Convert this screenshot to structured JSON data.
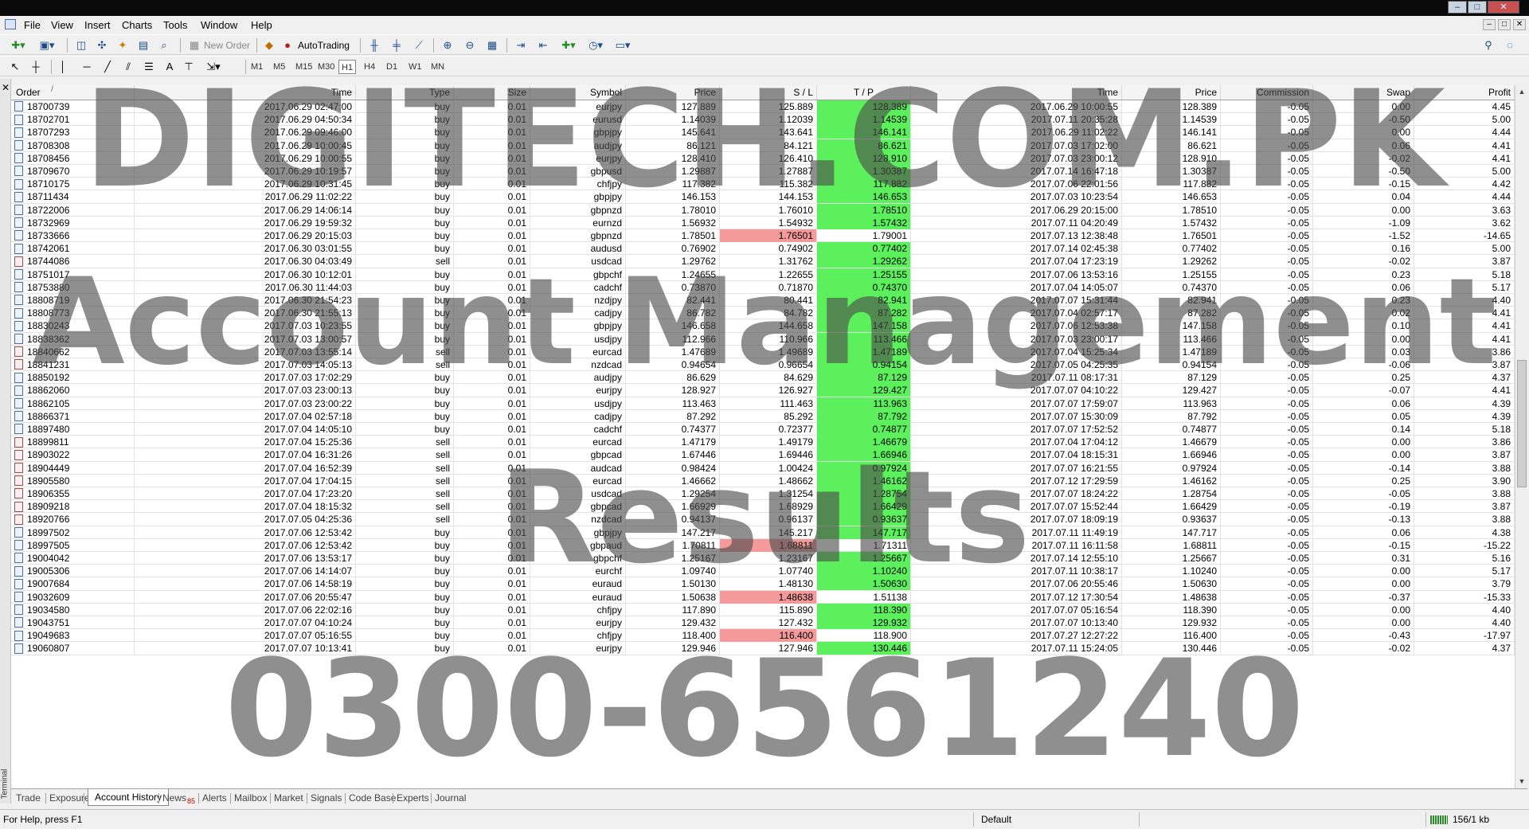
{
  "window": {
    "controls": [
      "–",
      "□",
      "✕"
    ]
  },
  "menu": [
    "File",
    "View",
    "Insert",
    "Charts",
    "Tools",
    "Window",
    "Help"
  ],
  "toolbar": {
    "new_order_label": "New Order",
    "autotrading_label": "AutoTrading",
    "timeframes": [
      "M1",
      "M5",
      "M15",
      "M30",
      "H1",
      "H4",
      "D1",
      "W1",
      "MN"
    ],
    "active_timeframe": "H1"
  },
  "terminal_label": "Terminal",
  "table": {
    "columns": [
      "Order",
      "Time",
      "Type",
      "Size",
      "Symbol",
      "Price",
      "S / L",
      "T / P",
      "Time",
      "Price",
      "Commission",
      "Swap",
      "Profit"
    ],
    "sort_indicator": "/",
    "rows": [
      [
        "18700739",
        "2017.06.29 02:47:00",
        "buy",
        "0.01",
        "eurjpy",
        "127.889",
        "125.889",
        "128.389",
        "2017.06.29 10:00:55",
        "128.389",
        "-0.05",
        "0.00",
        "4.45",
        "tp"
      ],
      [
        "18702701",
        "2017.06.29 04:50:34",
        "buy",
        "0.01",
        "eurusd",
        "1.14039",
        "1.12039",
        "1.14539",
        "2017.07.11 20:35:28",
        "1.14539",
        "-0.05",
        "-0.50",
        "5.00",
        "tp"
      ],
      [
        "18707293",
        "2017.06.29 09:46:00",
        "buy",
        "0.01",
        "gbpjpy",
        "145.641",
        "143.641",
        "146.141",
        "2017.06.29 11:02:22",
        "146.141",
        "-0.05",
        "0.00",
        "4.44",
        "tp"
      ],
      [
        "18708308",
        "2017.06.29 10:00:45",
        "buy",
        "0.01",
        "audjpy",
        "86.121",
        "84.121",
        "86.621",
        "2017.07.03 17:02:00",
        "86.621",
        "-0.05",
        "0.06",
        "4.41",
        "tp"
      ],
      [
        "18708456",
        "2017.06.29 10:00:55",
        "buy",
        "0.01",
        "eurjpy",
        "128.410",
        "126.410",
        "128.910",
        "2017.07.03 23:00:12",
        "128.910",
        "-0.05",
        "-0.02",
        "4.41",
        "tp"
      ],
      [
        "18709670",
        "2017.06.29 10:19:57",
        "buy",
        "0.01",
        "gbpusd",
        "1.29887",
        "1.27887",
        "1.30387",
        "2017.07.14 16:47:18",
        "1.30387",
        "-0.05",
        "-0.50",
        "5.00",
        "tp"
      ],
      [
        "18710175",
        "2017.06.29 10:31:45",
        "buy",
        "0.01",
        "chfjpy",
        "117.382",
        "115.382",
        "117.882",
        "2017.07.06 22:01:56",
        "117.882",
        "-0.05",
        "-0.15",
        "4.42",
        "tp"
      ],
      [
        "18711434",
        "2017.06.29 11:02:22",
        "buy",
        "0.01",
        "gbpjpy",
        "146.153",
        "144.153",
        "146.653",
        "2017.07.03 10:23:54",
        "146.653",
        "-0.05",
        "0.04",
        "4.44",
        "tp"
      ],
      [
        "18722006",
        "2017.06.29 14:06:14",
        "buy",
        "0.01",
        "gbpnzd",
        "1.78010",
        "1.76010",
        "1.78510",
        "2017.06.29 20:15:00",
        "1.78510",
        "-0.05",
        "0.00",
        "3.63",
        "tp"
      ],
      [
        "18732969",
        "2017.06.29 19:59:32",
        "buy",
        "0.01",
        "eurnzd",
        "1.56932",
        "1.54932",
        "1.57432",
        "2017.07.11 04:20:49",
        "1.57432",
        "-0.05",
        "-1.09",
        "3.62",
        "tp"
      ],
      [
        "18733666",
        "2017.06.29 20:15:03",
        "buy",
        "0.01",
        "gbpnzd",
        "1.78501",
        "1.76501",
        "1.79001",
        "2017.07.13 12:38:48",
        "1.76501",
        "-0.05",
        "-1.52",
        "-14.65",
        "sl"
      ],
      [
        "18742061",
        "2017.06.30 03:01:55",
        "buy",
        "0.01",
        "audusd",
        "0.76902",
        "0.74902",
        "0.77402",
        "2017.07.14 02:45:38",
        "0.77402",
        "-0.05",
        "0.16",
        "5.00",
        "tp"
      ],
      [
        "18744086",
        "2017.06.30 04:03:49",
        "sell",
        "0.01",
        "usdcad",
        "1.29762",
        "1.31762",
        "1.29262",
        "2017.07.04 17:23:19",
        "1.29262",
        "-0.05",
        "-0.02",
        "3.87",
        "tp"
      ],
      [
        "18751017",
        "2017.06.30 10:12:01",
        "buy",
        "0.01",
        "gbpchf",
        "1.24655",
        "1.22655",
        "1.25155",
        "2017.07.06 13:53:16",
        "1.25155",
        "-0.05",
        "0.23",
        "5.18",
        "tp"
      ],
      [
        "18753880",
        "2017.06.30 11:44:03",
        "buy",
        "0.01",
        "cadchf",
        "0.73870",
        "0.71870",
        "0.74370",
        "2017.07.04 14:05:07",
        "0.74370",
        "-0.05",
        "0.06",
        "5.17",
        "tp"
      ],
      [
        "18808719",
        "2017.06.30 21:54:23",
        "buy",
        "0.01",
        "nzdjpy",
        "82.441",
        "80.441",
        "82.941",
        "2017.07.07 15:31:44",
        "82.941",
        "-0.05",
        "0.23",
        "4.40",
        "tp"
      ],
      [
        "18808773",
        "2017.06.30 21:55:13",
        "buy",
        "0.01",
        "cadjpy",
        "86.782",
        "84.782",
        "87.282",
        "2017.07.04 02:57:17",
        "87.282",
        "-0.05",
        "0.02",
        "4.41",
        "tp"
      ],
      [
        "18830243",
        "2017.07.03 10:23:55",
        "buy",
        "0.01",
        "gbpjpy",
        "146.658",
        "144.658",
        "147.158",
        "2017.07.06 12:53:38",
        "147.158",
        "-0.05",
        "0.10",
        "4.41",
        "tp"
      ],
      [
        "18838362",
        "2017.07.03 13:00:57",
        "buy",
        "0.01",
        "usdjpy",
        "112.966",
        "110.966",
        "113.466",
        "2017.07.03 23:00:17",
        "113.466",
        "-0.05",
        "0.00",
        "4.41",
        "tp"
      ],
      [
        "18840662",
        "2017.07.03 13:55:14",
        "sell",
        "0.01",
        "eurcad",
        "1.47689",
        "1.49689",
        "1.47189",
        "2017.07.04 15:25:34",
        "1.47189",
        "-0.05",
        "0.03",
        "3.86",
        "tp"
      ],
      [
        "18841231",
        "2017.07.03 14:05:13",
        "sell",
        "0.01",
        "nzdcad",
        "0.94654",
        "0.96654",
        "0.94154",
        "2017.07.05 04:25:35",
        "0.94154",
        "-0.05",
        "-0.06",
        "3.87",
        "tp"
      ],
      [
        "18850192",
        "2017.07.03 17:02:29",
        "buy",
        "0.01",
        "audjpy",
        "86.629",
        "84.629",
        "87.129",
        "2017.07.11 08:17:31",
        "87.129",
        "-0.05",
        "0.25",
        "4.37",
        "tp"
      ],
      [
        "18862060",
        "2017.07.03 23:00:13",
        "buy",
        "0.01",
        "eurjpy",
        "128.927",
        "126.927",
        "129.427",
        "2017.07.07 04:10:22",
        "129.427",
        "-0.05",
        "-0.07",
        "4.41",
        "tp"
      ],
      [
        "18862105",
        "2017.07.03 23:00:22",
        "buy",
        "0.01",
        "usdjpy",
        "113.463",
        "111.463",
        "113.963",
        "2017.07.07 17:59:07",
        "113.963",
        "-0.05",
        "0.06",
        "4.39",
        "tp"
      ],
      [
        "18866371",
        "2017.07.04 02:57:18",
        "buy",
        "0.01",
        "cadjpy",
        "87.292",
        "85.292",
        "87.792",
        "2017.07.07 15:30:09",
        "87.792",
        "-0.05",
        "0.05",
        "4.39",
        "tp"
      ],
      [
        "18897480",
        "2017.07.04 14:05:10",
        "buy",
        "0.01",
        "cadchf",
        "0.74377",
        "0.72377",
        "0.74877",
        "2017.07.07 17:52:52",
        "0.74877",
        "-0.05",
        "0.14",
        "5.18",
        "tp"
      ],
      [
        "18899811",
        "2017.07.04 15:25:36",
        "sell",
        "0.01",
        "eurcad",
        "1.47179",
        "1.49179",
        "1.46679",
        "2017.07.04 17:04:12",
        "1.46679",
        "-0.05",
        "0.00",
        "3.86",
        "tp"
      ],
      [
        "18903022",
        "2017.07.04 16:31:26",
        "sell",
        "0.01",
        "gbpcad",
        "1.67446",
        "1.69446",
        "1.66946",
        "2017.07.04 18:15:31",
        "1.66946",
        "-0.05",
        "0.00",
        "3.87",
        "tp"
      ],
      [
        "18904449",
        "2017.07.04 16:52:39",
        "sell",
        "0.01",
        "audcad",
        "0.98424",
        "1.00424",
        "0.97924",
        "2017.07.07 16:21:55",
        "0.97924",
        "-0.05",
        "-0.14",
        "3.88",
        "tp"
      ],
      [
        "18905580",
        "2017.07.04 17:04:15",
        "sell",
        "0.01",
        "eurcad",
        "1.46662",
        "1.48662",
        "1.46162",
        "2017.07.12 17:29:59",
        "1.46162",
        "-0.05",
        "0.25",
        "3.90",
        "tp"
      ],
      [
        "18906355",
        "2017.07.04 17:23:20",
        "sell",
        "0.01",
        "usdcad",
        "1.29254",
        "1.31254",
        "1.28754",
        "2017.07.07 18:24:22",
        "1.28754",
        "-0.05",
        "-0.05",
        "3.88",
        "tp"
      ],
      [
        "18909218",
        "2017.07.04 18:15:32",
        "sell",
        "0.01",
        "gbpcad",
        "1.66929",
        "1.68929",
        "1.66429",
        "2017.07.07 15:52:44",
        "1.66429",
        "-0.05",
        "-0.19",
        "3.87",
        "tp"
      ],
      [
        "18920766",
        "2017.07.05 04:25:36",
        "sell",
        "0.01",
        "nzdcad",
        "0.94137",
        "0.96137",
        "0.93637",
        "2017.07.07 18:09:19",
        "0.93637",
        "-0.05",
        "-0.13",
        "3.88",
        "tp"
      ],
      [
        "18997502",
        "2017.07.06 12:53:42",
        "buy",
        "0.01",
        "gbpjpy",
        "147.217",
        "145.217",
        "147.717",
        "2017.07.11 11:49:19",
        "147.717",
        "-0.05",
        "0.06",
        "4.38",
        "tp"
      ],
      [
        "18997505",
        "2017.07.06 12:53:42",
        "buy",
        "0.01",
        "gbpaud",
        "1.70811",
        "1.68811",
        "1.71311",
        "2017.07.11 16:11:58",
        "1.68811",
        "-0.05",
        "-0.15",
        "-15.22",
        "sl"
      ],
      [
        "19004042",
        "2017.07.06 13:53:17",
        "buy",
        "0.01",
        "gbpchf",
        "1.25167",
        "1.23167",
        "1.25667",
        "2017.07.14 12:55:10",
        "1.25667",
        "-0.05",
        "0.31",
        "5.16",
        "tp"
      ],
      [
        "19005306",
        "2017.07.06 14:14:07",
        "buy",
        "0.01",
        "eurchf",
        "1.09740",
        "1.07740",
        "1.10240",
        "2017.07.11 10:38:17",
        "1.10240",
        "-0.05",
        "0.00",
        "5.17",
        "tp"
      ],
      [
        "19007684",
        "2017.07.06 14:58:19",
        "buy",
        "0.01",
        "euraud",
        "1.50130",
        "1.48130",
        "1.50630",
        "2017.07.06 20:55:46",
        "1.50630",
        "-0.05",
        "0.00",
        "3.79",
        "tp"
      ],
      [
        "19032609",
        "2017.07.06 20:55:47",
        "buy",
        "0.01",
        "euraud",
        "1.50638",
        "1.48638",
        "1.51138",
        "2017.07.12 17:30:54",
        "1.48638",
        "-0.05",
        "-0.37",
        "-15.33",
        "sl"
      ],
      [
        "19034580",
        "2017.07.06 22:02:16",
        "buy",
        "0.01",
        "chfjpy",
        "117.890",
        "115.890",
        "118.390",
        "2017.07.07 05:16:54",
        "118.390",
        "-0.05",
        "0.00",
        "4.40",
        "tp"
      ],
      [
        "19043751",
        "2017.07.07 04:10:24",
        "buy",
        "0.01",
        "eurjpy",
        "129.432",
        "127.432",
        "129.932",
        "2017.07.07 10:13:40",
        "129.932",
        "-0.05",
        "0.00",
        "4.40",
        "tp"
      ],
      [
        "19049683",
        "2017.07.07 05:16:55",
        "buy",
        "0.01",
        "chfjpy",
        "118.400",
        "116.400",
        "118.900",
        "2017.07.27 12:27:22",
        "116.400",
        "-0.05",
        "-0.43",
        "-17.97",
        "sl"
      ],
      [
        "19060807",
        "2017.07.07 10:13:41",
        "buy",
        "0.01",
        "eurjpy",
        "129.946",
        "127.946",
        "130.446",
        "2017.07.11 15:24:05",
        "130.446",
        "-0.05",
        "-0.02",
        "4.37",
        "tp"
      ]
    ]
  },
  "tabs": [
    {
      "label": "Trade",
      "badge": ""
    },
    {
      "label": "Exposure",
      "badge": ""
    },
    {
      "label": "Account History",
      "badge": ""
    },
    {
      "label": "News",
      "badge": "85"
    },
    {
      "label": "Alerts",
      "badge": ""
    },
    {
      "label": "Mailbox",
      "badge": ""
    },
    {
      "label": "Market",
      "badge": ""
    },
    {
      "label": "Signals",
      "badge": ""
    },
    {
      "label": "Code Base",
      "badge": ""
    },
    {
      "label": "Experts",
      "badge": ""
    },
    {
      "label": "Journal",
      "badge": ""
    }
  ],
  "active_tab": "Account History",
  "status": {
    "help": "For Help, press F1",
    "profile": "Default",
    "traffic": "156/1 kb"
  },
  "watermark": {
    "line1": "DIGITECH.COM.PK",
    "line2": "Account Management",
    "line3": "Results",
    "line4": "0300-6561240"
  },
  "colors": {
    "tp_hit": "#5cf05c",
    "sl_hit": "#f49a9a"
  }
}
